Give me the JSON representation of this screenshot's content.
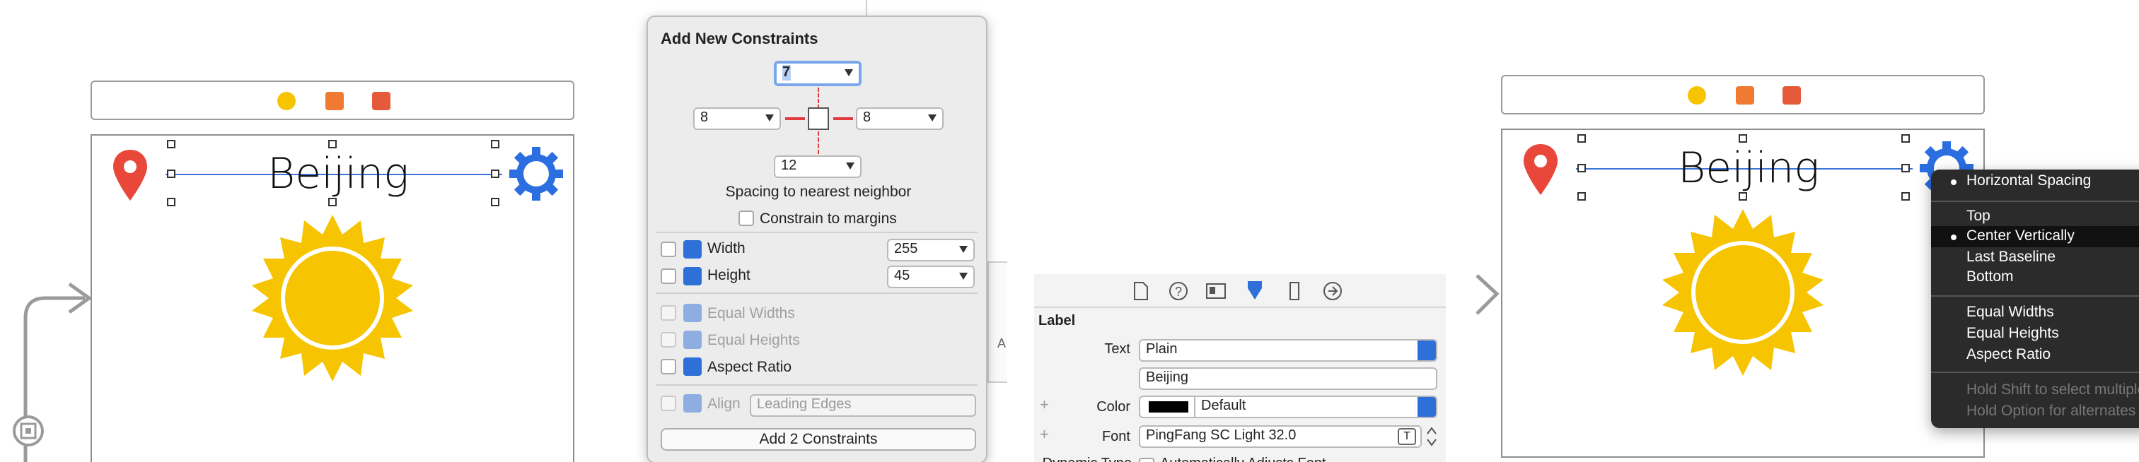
{
  "scene_left": {
    "city": "Beijing"
  },
  "popover": {
    "title": "Add New Constraints",
    "top_value": "7",
    "left_value": "8",
    "right_value": "8",
    "bottom_value": "12",
    "caption": "Spacing to nearest neighbor",
    "constrain_margins": "Constrain to margins",
    "width_label": "Width",
    "width_value": "255",
    "height_label": "Height",
    "height_value": "45",
    "equal_widths": "Equal Widths",
    "equal_heights": "Equal Heights",
    "aspect_ratio": "Aspect Ratio",
    "align_label": "Align",
    "align_value": "Leading Edges",
    "add_button": "Add 2 Constraints"
  },
  "behind_popover_text": "A",
  "inspector": {
    "section": "Label",
    "text_label": "Text",
    "text_type": "Plain",
    "text_value": "Beijing",
    "color_label": "Color",
    "color_value": "Default",
    "color_swatch": "#000000",
    "font_label": "Font",
    "font_value": "PingFang SC Light 32.0",
    "dynamic_label": "Dynamic Type",
    "dynamic_value": "Automatically Adjusts Font"
  },
  "scene_right": {
    "city": "Beijing"
  },
  "menu": {
    "items": [
      "Horizontal Spacing",
      "Top",
      "Center Vertically",
      "Last Baseline",
      "Bottom",
      "Equal Widths",
      "Equal Heights",
      "Aspect Ratio",
      "Hold Shift to select multiple",
      "Hold Option for alternates"
    ]
  },
  "colors": {
    "accent": "#2f6fd8",
    "sun": "#f6c400",
    "gear": "#2a6ee0",
    "pin": "#e8473a",
    "constraint": "#e0393e"
  }
}
